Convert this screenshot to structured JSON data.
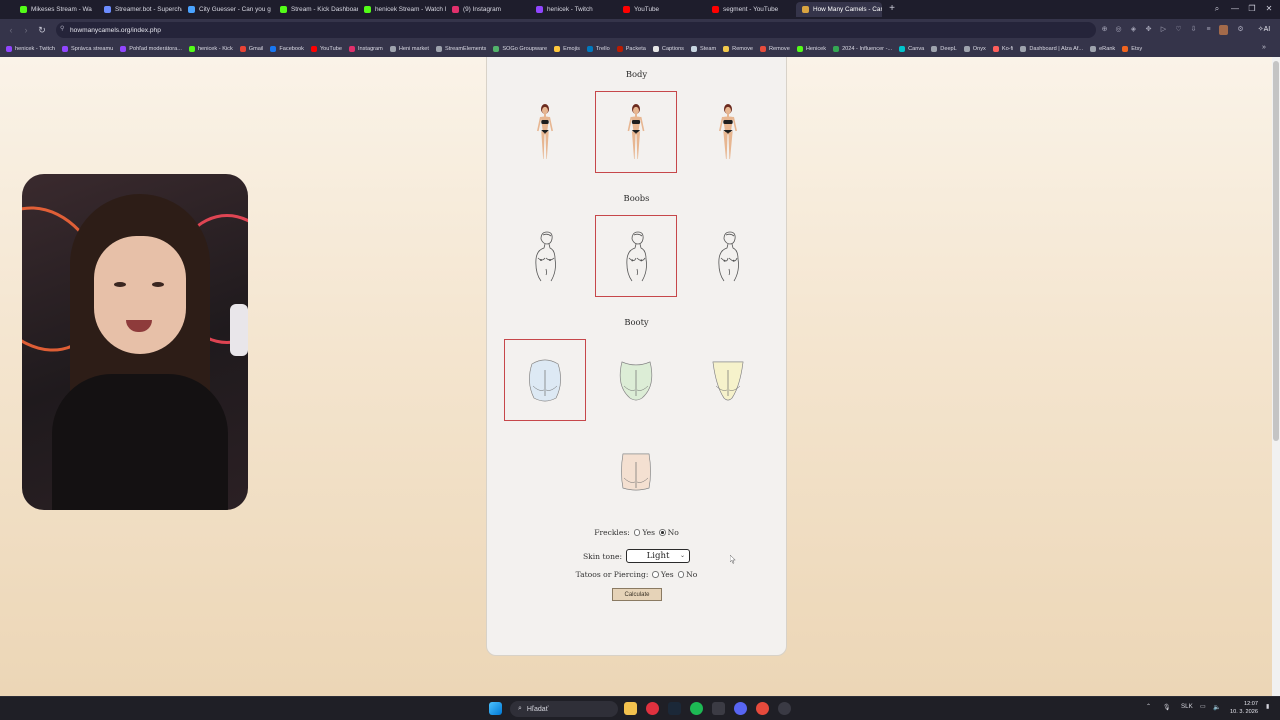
{
  "browser": {
    "tabs": [
      {
        "label": "Mikeses Stream - Wa",
        "favicon_color": "#53fc18",
        "active": false
      },
      {
        "label": "Streamer.bot - Superchar",
        "favicon_color": "#6c8cff",
        "active": false
      },
      {
        "label": "City Guesser - Can you g",
        "favicon_color": "#4aa3ff",
        "active": false
      },
      {
        "label": "Stream - Kick Dashboard",
        "favicon_color": "#53fc18",
        "active": false
      },
      {
        "label": "henicek Stream - Watch l",
        "favicon_color": "#53fc18",
        "active": false
      },
      {
        "label": "(9) Instagram",
        "favicon_color": "#e1306c",
        "active": false
      },
      {
        "label": "henicek - Twitch",
        "favicon_color": "#9146ff",
        "active": false
      },
      {
        "label": "YouTube",
        "favicon_color": "#ff0000",
        "active": false
      },
      {
        "label": "segment - YouTube",
        "favicon_color": "#ff0000",
        "active": false
      },
      {
        "label": "How Many Camels - Cam",
        "favicon_color": "#d9a441",
        "active": true
      }
    ],
    "new_tab_icon": "plus-icon",
    "window_controls": {
      "search": "⌕",
      "minimize": "—",
      "restore": "❐",
      "close": "✕"
    },
    "address": "howmanycamels.org/index.php",
    "bookmarks": [
      {
        "label": "henicek - Twitch",
        "color": "#9146ff"
      },
      {
        "label": "Správca streamu",
        "color": "#9146ff"
      },
      {
        "label": "Pohľad moderátora...",
        "color": "#9146ff"
      },
      {
        "label": "henicek - Kick",
        "color": "#53fc18"
      },
      {
        "label": "Gmail",
        "color": "#ea4335"
      },
      {
        "label": "Facebook",
        "color": "#1877f2"
      },
      {
        "label": "YouTube",
        "color": "#ff0000"
      },
      {
        "label": "Instagram",
        "color": "#e1306c"
      },
      {
        "label": "Heni market",
        "color": "#9ea3ad"
      },
      {
        "label": "StreamElements",
        "color": "#9ea3ad"
      },
      {
        "label": "SOGo Groupware",
        "color": "#52b36b"
      },
      {
        "label": "Emojis",
        "color": "#ffc83d"
      },
      {
        "label": "Trello",
        "color": "#0079bf"
      },
      {
        "label": "Packeta",
        "color": "#ba1b02"
      },
      {
        "label": "Captions",
        "color": "#e6e6e6"
      },
      {
        "label": "Steam",
        "color": "#c7d5e0"
      },
      {
        "label": "Remove",
        "color": "#f2c94c"
      },
      {
        "label": "Remove",
        "color": "#e74c3c"
      },
      {
        "label": "Henicek",
        "color": "#53fc18"
      },
      {
        "label": "2024 - Influencer -...",
        "color": "#34a853"
      },
      {
        "label": "Canva",
        "color": "#00c4cc"
      },
      {
        "label": "DeepL",
        "color": "#9ea3ad"
      },
      {
        "label": "Onyx",
        "color": "#9ea3ad"
      },
      {
        "label": "Ko-fi",
        "color": "#ff5e5b"
      },
      {
        "label": "Dashboard | Alza Af...",
        "color": "#9ea3ad"
      },
      {
        "label": "eRank",
        "color": "#9ea3ad"
      },
      {
        "label": "Etsy",
        "color": "#f1641e"
      }
    ]
  },
  "page": {
    "sections": {
      "body": {
        "title": "Body",
        "selected_index": 1
      },
      "boobs": {
        "title": "Boobs",
        "selected_index": 1
      },
      "booty": {
        "title": "Booty",
        "selected_index": 0,
        "option_colors": [
          "#a9cdee",
          "#a8d89a",
          "#f0e67a",
          "#e9b48c"
        ]
      }
    },
    "freckles": {
      "label": "Freckles:",
      "options": [
        "Yes",
        "No"
      ],
      "selected": "No"
    },
    "skin_tone": {
      "label": "Skin tone:",
      "value": "Light"
    },
    "tattoos": {
      "label": "Tatoos or Piercing:",
      "options": [
        "Yes",
        "No"
      ],
      "selected": null
    },
    "calculate_label": "Calculate"
  },
  "taskbar": {
    "search_placeholder": "Hľadať",
    "language": "SLK",
    "time": "12:07",
    "date": "10. 3. 2026"
  }
}
